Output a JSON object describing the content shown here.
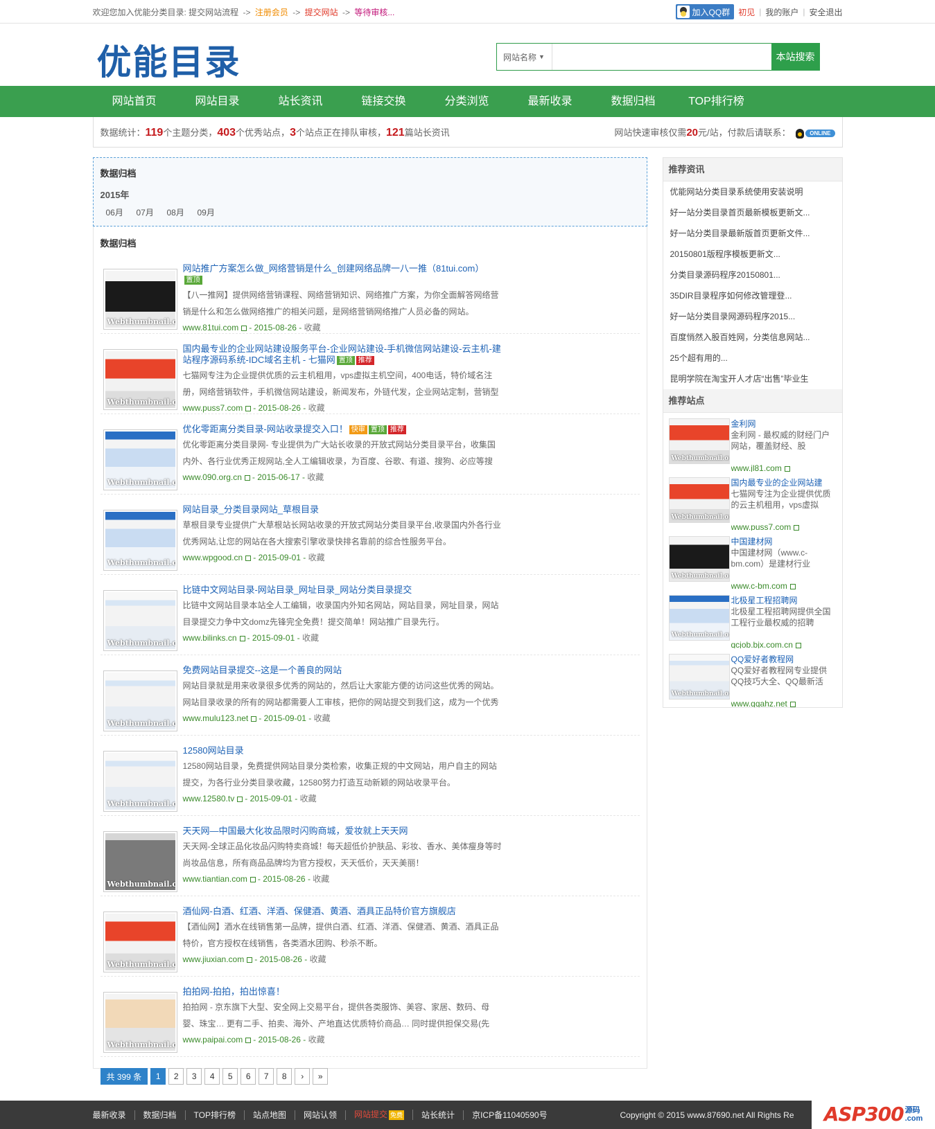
{
  "topbar": {
    "welcome": "欢迎您加入优能分类目录: 提交网站流程",
    "arrow": "->",
    "step1": "注册会员",
    "step2": "提交网站",
    "step3": "等待审核...",
    "qq_group": "加入QQ群",
    "user": "初见",
    "account": "我的账户",
    "logout": "安全退出",
    "sep": "|"
  },
  "header": {
    "logo": "优能目录",
    "search_type": "网站名称",
    "search_placeholder": "",
    "search_button": "本站搜索"
  },
  "nav": [
    "网站首页",
    "网站目录",
    "站长资讯",
    "链接交换",
    "分类浏览",
    "最新收录",
    "数据归档",
    "TOP排行榜"
  ],
  "stats": {
    "label": "数据统计：",
    "categories": "119",
    "categories_text": "个主题分类，",
    "sites": "403",
    "sites_text": "个优秀站点，",
    "pending": "3",
    "pending_text": "个站点正在排队审核，",
    "news": "121",
    "news_text": "篇站长资讯",
    "fast_review_pre": "网站快速审核仅需",
    "price": "20",
    "fast_review_post": "元/站，付款后请联系：",
    "online": "ONLINE"
  },
  "archive": {
    "title": "数据归档",
    "year": "2015年",
    "months": [
      "06月",
      "07月",
      "08月",
      "09月"
    ]
  },
  "listing": {
    "title": "数据归档",
    "entries": [
      {
        "title": "网站推广方案怎么做_网络营销是什么_创建网络品牌一八一推（81tui.com）",
        "badges": [
          {
            "text": "置顶",
            "color": "green"
          }
        ],
        "desc": "【八一推网】提供网络营销课程、网络营销知识、网络推广方案，为你全面解答网络营销是什么和怎么做网络推广的相关问题，是网络营销网络推广人员必备的网站。",
        "url": "www.81tui.com",
        "date": "2015-08-26",
        "fav": "收藏",
        "thumb": "dark"
      },
      {
        "title": "国内最专业的企业网站建设服务平台-企业网站建设-手机微信网站建设-云主机-建站程序源码系统-IDC域名主机 - 七猫网",
        "badges": [
          {
            "text": "置顶",
            "color": "green"
          },
          {
            "text": "推荐",
            "color": "red"
          }
        ],
        "desc": "七猫网专注为企业提供优质的云主机租用，vps虚拟主机空间，400电话，特价域名注册，网络营销软件，手机微信网站建设，新闻发布，外链代发，企业网站定制，营销型",
        "url": "www.puss7.com",
        "date": "2015-08-26",
        "fav": "收藏",
        "thumb": "red"
      },
      {
        "title": "优化零距离分类目录-网站收录提交入口！",
        "badges": [
          {
            "text": "快审",
            "color": "orange"
          },
          {
            "text": "置顶",
            "color": "green"
          },
          {
            "text": "推荐",
            "color": "red"
          }
        ],
        "desc": "优化零距离分类目录网- 专业提供为广大站长收录的开放式网站分类目录平台，收集国内外、各行业优秀正规网站,全人工编辑收录，为百度、谷歌、有道、搜狗、必应等搜",
        "url": "www.090.org.cn",
        "date": "2015-06-17",
        "fav": "收藏",
        "thumb": "blue"
      },
      {
        "title": "网站目录_分类目录网站_草根目录",
        "badges": [],
        "desc": "草根目录专业提供广大草根站长网站收录的开放式网站分类目录平台,收录国内外各行业优秀网站,让您的网站在各大搜索引擎收录快排名靠前的综合性服务平台。",
        "url": "www.wpgood.cn",
        "date": "2015-09-01",
        "fav": "收藏",
        "thumb": "blue"
      },
      {
        "title": "比链中文网站目录-网站目录_网址目录_网站分类目录提交",
        "badges": [],
        "desc": "比链中文网站目录本站全人工编辑，收录国内外知名网站，网站目录，网址目录，网站目录提交力争中文domz先锋完全免费！提交简单！网站推广目录先行。",
        "url": "www.bilinks.cn",
        "date": "2015-09-01",
        "fav": "收藏",
        "thumb": "light"
      },
      {
        "title": "免费网站目录提交--这是一个善良的网站",
        "badges": [],
        "desc": "网站目录就是用来收录很多优秀的网站的，然后让大家能方便的访问这些优秀的网站。网站目录收录的所有的网站都需要人工审核，把你的网站提交到我们这，成为一个优秀",
        "url": "www.mulu123.net",
        "date": "2015-09-01",
        "fav": "收藏",
        "thumb": "light"
      },
      {
        "title": "12580网站目录",
        "badges": [],
        "desc": "12580网站目录，免费提供网站目录分类检索，收集正规的中文网站，用户自主的网站提交，为各行业分类目录收藏，12580努力打造互动新颖的网站收录平台。",
        "url": "www.12580.tv",
        "date": "2015-09-01",
        "fav": "收藏",
        "thumb": "light"
      },
      {
        "title": "天天网—中国最大化妆品限时闪购商城，爱妆就上天天网",
        "badges": [],
        "desc": "天天网-全球正品化妆品闪购特卖商城！每天超低价护肤品、彩妆、香水、美体瘦身等时尚妆品信息，所有商品品牌均为官方授权，天天低价，天天美丽！",
        "url": "www.tiantian.com",
        "date": "2015-08-26",
        "fav": "收藏",
        "thumb": "gray"
      },
      {
        "title": "酒仙网-白酒、红酒、洋酒、保健酒、黄酒、酒具正品特价官方旗舰店",
        "badges": [],
        "desc": "【酒仙网】酒水在线销售第一品牌，提供白酒、红酒、洋酒、保健酒、黄酒、酒具正品特价，官方授权在线销售，各类酒水团购、秒杀不断。",
        "url": "www.jiuxian.com",
        "date": "2015-08-26",
        "fav": "收藏",
        "thumb": "red"
      },
      {
        "title": "拍拍网-拍拍，拍出惊喜！",
        "badges": [],
        "desc": "拍拍网 - 京东旗下大型、安全网上交易平台，提供各类服饰、美容、家居、数码、母婴、珠宝… 更有二手、拍卖、海外、产地直达优质特价商品… 同时提供担保交易(先",
        "url": "www.paipai.com",
        "date": "2015-08-26",
        "fav": "收藏",
        "thumb": "show"
      }
    ]
  },
  "pager": {
    "total": "共 399 条",
    "pages": [
      "1",
      "2",
      "3",
      "4",
      "5",
      "6",
      "7",
      "8"
    ],
    "next": "›",
    "last": "»"
  },
  "sidebar": {
    "news_title": "推荐资讯",
    "news": [
      "优能网站分类目录系统使用安装说明",
      "好一站分类目录首页最新模板更新文...",
      "好一站分类目录最新版首页更新文件...",
      "20150801版程序模板更新文...",
      "分类目录源码程序20150801...",
      "35DIR目录程序如何修改管理登...",
      "好一站分类目录网源码程序2015...",
      "百度悄然入股百姓网，分类信息网站...",
      "25个超有用的...",
      "昆明学院在淘宝开人才店“出售”毕业生"
    ],
    "sites_title": "推荐站点",
    "sites": [
      {
        "name": "金利网",
        "desc": "金利网 - 最权威的财经门户网站，覆盖财经、股",
        "url": "www.jl81.com",
        "thumb": "red"
      },
      {
        "name": "国内最专业的企业网站建",
        "desc": "七猫网专注为企业提供优质的云主机租用，vps虚拟",
        "url": "www.puss7.com",
        "thumb": "red"
      },
      {
        "name": "中国建材网",
        "desc": "中国建材网（www.c-bm.com）是建材行业",
        "url": "www.c-bm.com",
        "thumb": "dark"
      },
      {
        "name": "北极星工程招聘网",
        "desc": "北极星工程招聘网提供全国工程行业最权威的招聘",
        "url": "qcjob.bjx.com.cn",
        "thumb": "blue"
      },
      {
        "name": "QQ爱好者教程网",
        "desc": "QQ爱好者教程网专业提供QQ技巧大全、QQ最新活",
        "url": "www.qqahz.net",
        "thumb": "light"
      }
    ]
  },
  "thumb_watermark": "Webthumbnail.org",
  "footer": {
    "links": [
      "最新收录",
      "数据归档",
      "TOP排行榜",
      "站点地图",
      "网站认领",
      "网站提交",
      "站长统计",
      "京ICP备11040590号"
    ],
    "hot_badge": "免费",
    "copyright": "Copyright © 2015 www.87690.net All Rights Re",
    "brand": "ASP300",
    "brand_sub1": "源码",
    "brand_sub2": ".com"
  },
  "colors": {
    "nav_green": "#3a9f4f",
    "logo_blue": "#1f5fa8",
    "link_blue": "#1d62b5",
    "stat_red": "#c5191c",
    "url_green": "#3a8a2a"
  }
}
